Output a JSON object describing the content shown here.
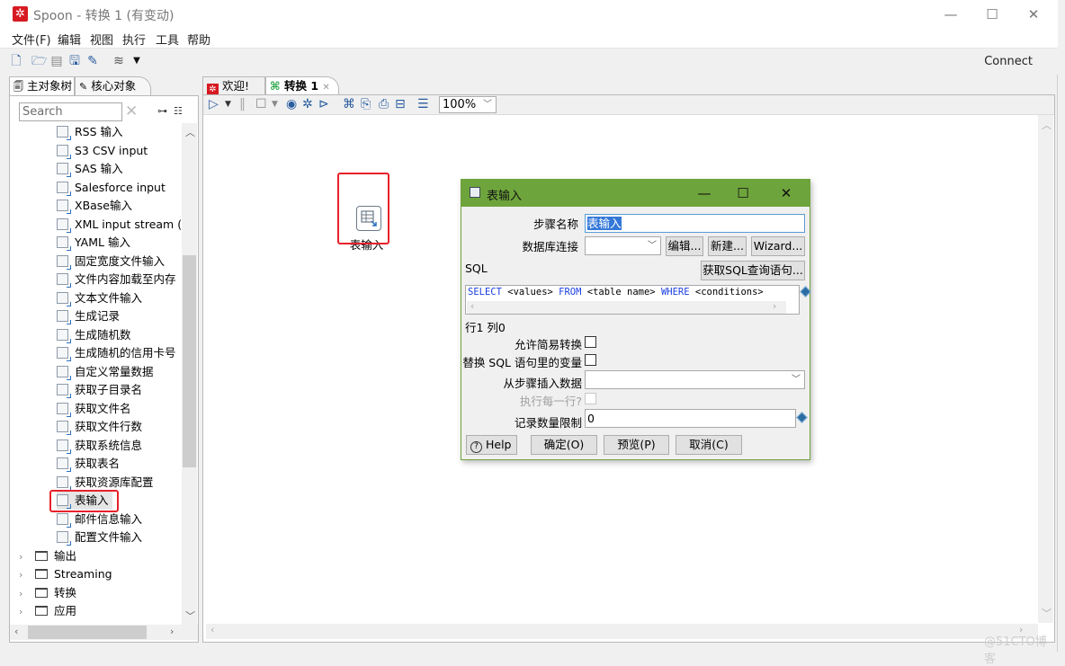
{
  "window": {
    "title": "Spoon - 转换 1 (有变动)",
    "app_icon": "spoon-logo-icon",
    "controls": {
      "minimize": "—",
      "maximize": "☐",
      "close": "✕"
    }
  },
  "menubar": [
    "文件(F)",
    "编辑",
    "视图",
    "执行",
    "工具",
    "帮助"
  ],
  "toolbar": {
    "icons": [
      "new-file-icon",
      "open-file-icon",
      "explore-repo-icon",
      "save-icon",
      "save-as-icon",
      "perspective-layers-icon",
      "dropdown-arrow-icon"
    ],
    "connect_label": "Connect"
  },
  "left_panel": {
    "tabs": [
      {
        "label": "主对象树",
        "icon": "object-tree-icon"
      },
      {
        "label": "核心对象",
        "icon": "pencil-icon"
      }
    ],
    "search": {
      "placeholder": "Search",
      "value": ""
    },
    "tree_items": [
      {
        "label": "RSS 输入",
        "type": "step"
      },
      {
        "label": "S3 CSV input",
        "type": "step"
      },
      {
        "label": "SAS 输入",
        "type": "step"
      },
      {
        "label": "Salesforce input",
        "type": "step"
      },
      {
        "label": "XBase输入",
        "type": "step"
      },
      {
        "label": "XML input stream (S",
        "type": "step"
      },
      {
        "label": "YAML 输入",
        "type": "step"
      },
      {
        "label": "固定宽度文件输入",
        "type": "step"
      },
      {
        "label": "文件内容加载至内存",
        "type": "step"
      },
      {
        "label": "文本文件输入",
        "type": "step"
      },
      {
        "label": "生成记录",
        "type": "step"
      },
      {
        "label": "生成随机数",
        "type": "step"
      },
      {
        "label": "生成随机的信用卡号",
        "type": "step"
      },
      {
        "label": "自定义常量数据",
        "type": "step"
      },
      {
        "label": "获取子目录名",
        "type": "step"
      },
      {
        "label": "获取文件名",
        "type": "step"
      },
      {
        "label": "获取文件行数",
        "type": "step"
      },
      {
        "label": "获取系统信息",
        "type": "step"
      },
      {
        "label": "获取表名",
        "type": "step"
      },
      {
        "label": "获取资源库配置",
        "type": "step"
      },
      {
        "label": "表输入",
        "type": "step",
        "highlighted": true
      },
      {
        "label": "邮件信息输入",
        "type": "step"
      },
      {
        "label": "配置文件输入",
        "type": "step"
      },
      {
        "label": "输出",
        "type": "folder"
      },
      {
        "label": "Streaming",
        "type": "folder"
      },
      {
        "label": "转换",
        "type": "folder"
      },
      {
        "label": "应用",
        "type": "folder"
      }
    ]
  },
  "right_panel": {
    "tabs": [
      {
        "label": "欢迎!",
        "icon": "spoon-logo-icon",
        "active": false
      },
      {
        "label": "转换 1",
        "icon": "transformation-icon",
        "active": true,
        "closable": true
      }
    ],
    "canvas_toolbar": {
      "icons": [
        "run-icon",
        "run-dropdown-icon",
        "pause-icon",
        "stop-icon",
        "stop-dropdown-icon",
        "preview-icon",
        "debug-icon",
        "replay-icon",
        "verify-icon",
        "impact-icon",
        "sql-icon",
        "explore-db-icon",
        "show-results-icon"
      ],
      "zoom": "100%"
    },
    "canvas_step": {
      "label": "表输入",
      "icon": "table-input-icon"
    }
  },
  "dialog": {
    "title": "表输入",
    "step_name_label": "步骤名称",
    "step_name_value": "表输入",
    "db_conn_label": "数据库连接",
    "db_conn_value": "",
    "edit_button": "编辑...",
    "new_button": "新建...",
    "wizard_button": "Wizard...",
    "sql_label": "SQL",
    "get_sql_button": "获取SQL查询语句...",
    "sql": {
      "kw1": "SELECT",
      "t1": " <values> ",
      "kw2": "FROM",
      "t2": " <table name> ",
      "kw3": "WHERE",
      "t3": " <conditions>"
    },
    "cursor_pos": "行1 列0",
    "lazy_conversion_label": "允许简易转换",
    "lazy_conversion_checked": false,
    "replace_vars_label": "替换 SQL 语句里的变量",
    "replace_vars_checked": false,
    "insert_from_step_label": "从步骤插入数据",
    "insert_from_step_value": "",
    "execute_each_row_label": "执行每一行?",
    "execute_each_row_checked": false,
    "limit_label": "记录数量限制",
    "limit_value": "0",
    "help_button": "Help",
    "ok_button": "确定(O)",
    "preview_button": "预览(P)",
    "cancel_button": "取消(C)"
  },
  "watermark": "@51CTO博客",
  "colors": {
    "dialog_title": "#6ea43c",
    "highlight_box": "#e8202a",
    "sql_keyword": "#1a3ee0",
    "app_red": "#d71921"
  }
}
